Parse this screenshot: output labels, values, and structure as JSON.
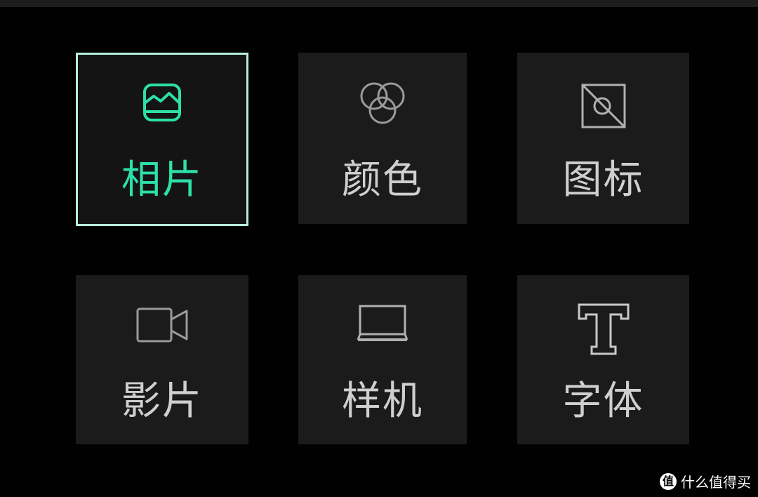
{
  "menu": {
    "items": [
      {
        "label": "相片",
        "icon": "photo-icon",
        "selected": true
      },
      {
        "label": "颜色",
        "icon": "color-icon",
        "selected": false
      },
      {
        "label": "图标",
        "icon": "icon-icon",
        "selected": false
      },
      {
        "label": "影片",
        "icon": "video-icon",
        "selected": false
      },
      {
        "label": "样机",
        "icon": "mockup-icon",
        "selected": false
      },
      {
        "label": "字体",
        "icon": "font-icon",
        "selected": false
      }
    ]
  },
  "watermark": {
    "logo_text": "值",
    "text": "什么值得买"
  },
  "colors": {
    "accent": "#2de0a7",
    "selected_border": "#b8efdc",
    "tile_bg": "#1b1b1b",
    "text": "#cfcfcf",
    "background": "#000000"
  }
}
